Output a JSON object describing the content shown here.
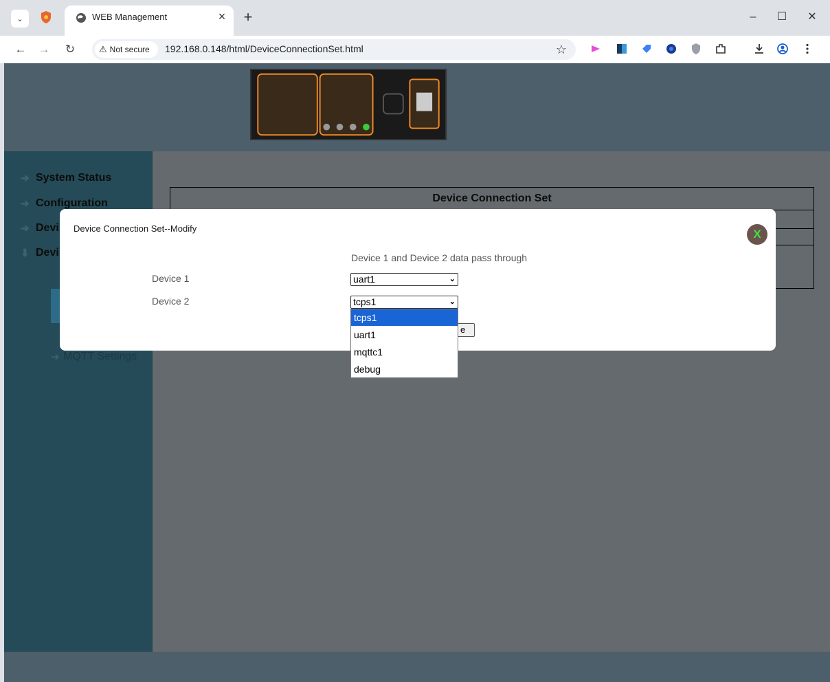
{
  "browser": {
    "tab_title": "WEB Management",
    "tab_close_glyph": "×",
    "new_tab_glyph": "+",
    "window_controls": [
      "–",
      "☐",
      "✕"
    ],
    "security_label": "Not secure",
    "url": "192.168.0.148/html/DeviceConnectionSet.html"
  },
  "sidebar": {
    "items": [
      "System Status",
      "Configuration",
      "Devi",
      "Devi"
    ],
    "sub_items": [
      "MQTT Settings"
    ]
  },
  "content": {
    "title": "Device Connection Set"
  },
  "modal": {
    "title": "Device Connection Set--Modify",
    "close_label": "X",
    "description": "Device 1 and Device 2 data pass through",
    "device1_label": "Device 1",
    "device1_value": "uart1",
    "device2_label": "Device 2",
    "device2_value": "tcps1",
    "button_partial": "e",
    "dropdown_options": [
      "tcps1",
      "uart1",
      "mqttc1",
      "debug"
    ],
    "dropdown_selected": "tcps1"
  },
  "colors": {
    "header": "#4c5f6a",
    "sidebar": "#244b57",
    "overlay": "#646a6d",
    "close_bg": "#6b5450",
    "close_fg": "#3ee53e",
    "selected_option": "#1a65d6"
  }
}
